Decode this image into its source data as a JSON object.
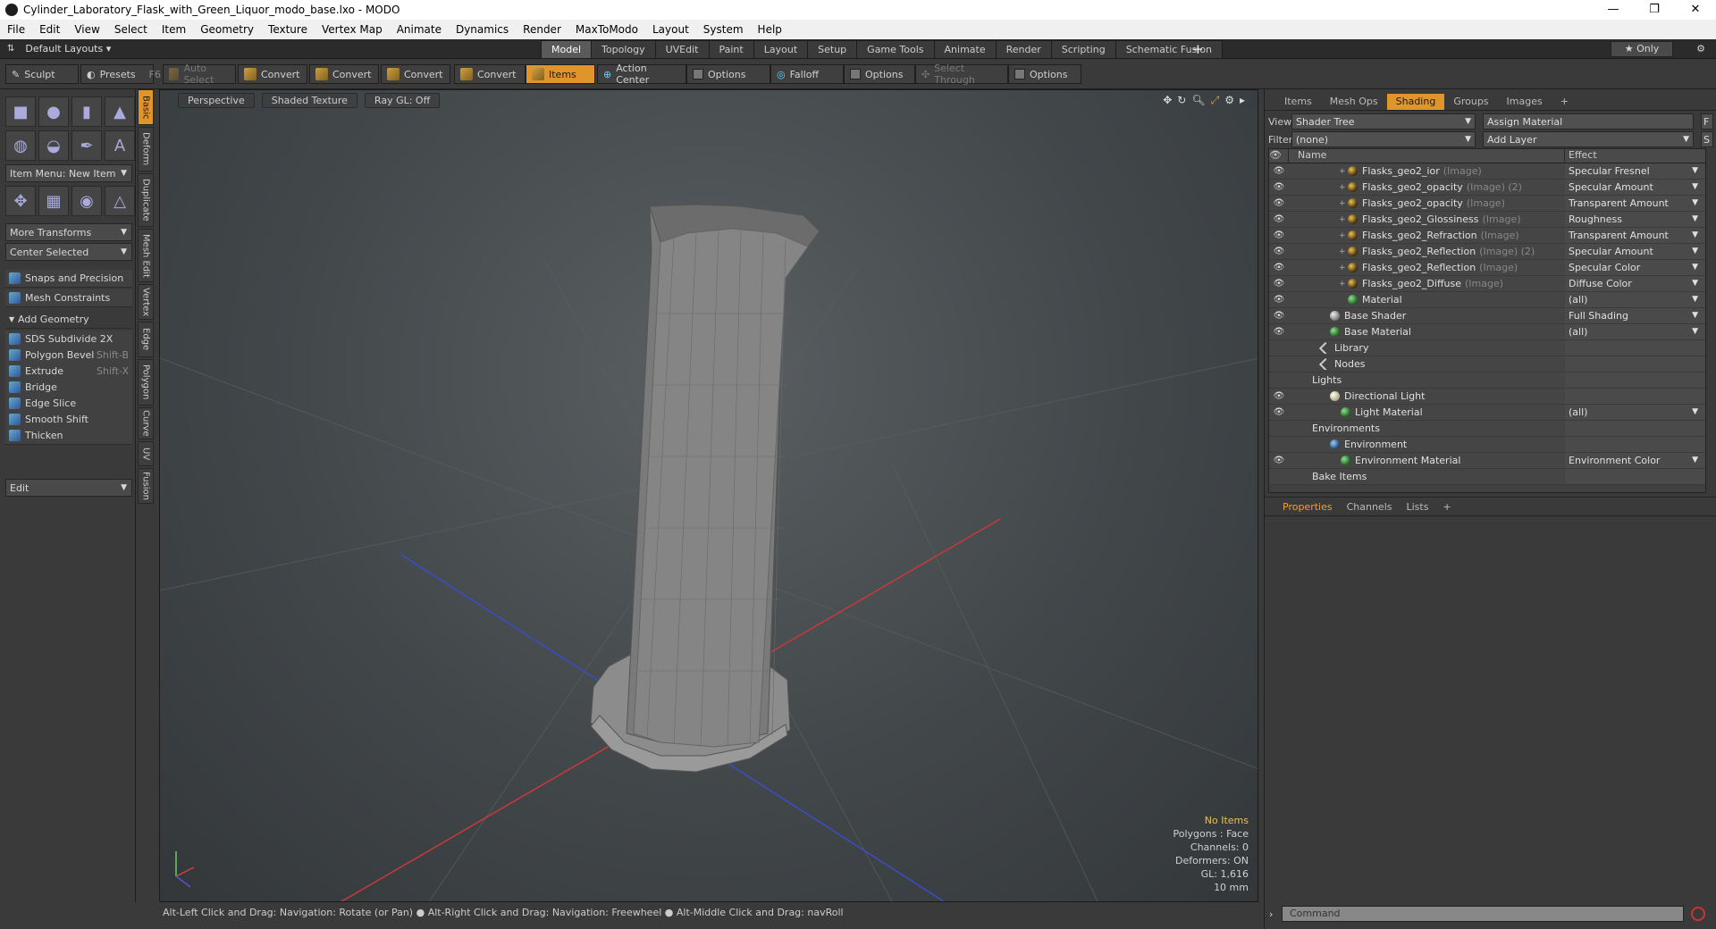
{
  "window": {
    "title": "Cylinder_Laboratory_Flask_with_Green_Liquor_modo_base.lxo - MODO",
    "minimize": "—",
    "maximize": "❐",
    "close": "✕"
  },
  "menu": [
    "File",
    "Edit",
    "View",
    "Select",
    "Item",
    "Geometry",
    "Texture",
    "Vertex Map",
    "Animate",
    "Dynamics",
    "Render",
    "MaxToModo",
    "Layout",
    "System",
    "Help"
  ],
  "layoutbar": {
    "default_layouts": "Default Layouts ▾",
    "tabs": [
      "Model",
      "Topology",
      "UVEdit",
      "Paint",
      "Layout",
      "Setup",
      "Game Tools",
      "Animate",
      "Render",
      "Scripting",
      "Schematic Fusion"
    ],
    "active_tab": "Model",
    "plus": "+",
    "only": "★  Only"
  },
  "toolbar": {
    "sculpt": "Sculpt",
    "presets": "Presets",
    "presets_shortcut": "F6",
    "auto_select": "Auto Select",
    "convert": "Convert",
    "items": "Items",
    "action_center": "Action Center",
    "options": "Options",
    "falloff": "Falloff",
    "select_through": "Select Through"
  },
  "leftpanel": {
    "item_menu": "Item Menu: New Item",
    "more_transforms": "More Transforms",
    "center_selected": "Center Selected",
    "snaps": "Snaps and Precision",
    "mesh_constraints": "Mesh Constraints",
    "add_geometry": "Add Geometry",
    "tools": [
      {
        "label": "SDS Subdivide 2X",
        "shortcut": ""
      },
      {
        "label": "Polygon Bevel",
        "shortcut": "Shift-B"
      },
      {
        "label": "Extrude",
        "shortcut": "Shift-X"
      },
      {
        "label": "Bridge",
        "shortcut": ""
      },
      {
        "label": "Edge Slice",
        "shortcut": ""
      },
      {
        "label": "Smooth Shift",
        "shortcut": ""
      },
      {
        "label": "Thicken",
        "shortcut": ""
      }
    ],
    "edit": "Edit",
    "sidetabs": [
      "Basic",
      "Deform",
      "Duplicate",
      "Mesh Edit",
      "Vertex",
      "Edge",
      "Polygon",
      "Curve",
      "UV",
      "Fusion"
    ]
  },
  "viewport": {
    "view": "Perspective",
    "shading": "Shaded Texture",
    "raygl": "Ray GL: Off",
    "info": {
      "no_items": "No Items",
      "polygons": "Polygons : Face",
      "channels": "Channels: 0",
      "deformers": "Deformers: ON",
      "gl": "GL: 1,616",
      "scale": "10 mm"
    }
  },
  "status": "Alt-Left Click and Drag: Navigation: Rotate (or Pan) ● Alt-Right Click and Drag: Navigation: Freewheel ● Alt-Middle Click and Drag: navRoll",
  "rightpanel": {
    "tabs": [
      "Items",
      "Mesh Ops",
      "Shading",
      "Groups",
      "Images",
      "+"
    ],
    "active_tab": "Shading",
    "view_label": "View",
    "view_value": "Shader Tree",
    "assign_material": "Assign Material",
    "filter_label": "Filter",
    "filter_value": "(none)",
    "add_layer": "Add Layer",
    "col_name": "Name",
    "col_effect": "Effect",
    "rows": [
      {
        "name": "Flasks_geo2_ior",
        "sub": "(Image)",
        "effect": "Specular Fresnel",
        "icon": "tex",
        "indent": 56,
        "eye": true
      },
      {
        "name": "Flasks_geo2_opacity",
        "sub": "(Image) (2)",
        "effect": "Specular Amount",
        "icon": "tex",
        "indent": 56,
        "eye": true
      },
      {
        "name": "Flasks_geo2_opacity",
        "sub": "(Image)",
        "effect": "Transparent Amount",
        "icon": "tex",
        "indent": 56,
        "eye": true
      },
      {
        "name": "Flasks_geo2_Glossiness",
        "sub": "(Image)",
        "effect": "Roughness",
        "icon": "tex",
        "indent": 56,
        "eye": true
      },
      {
        "name": "Flasks_geo2_Refraction",
        "sub": "(Image)",
        "effect": "Transparent Amount",
        "icon": "tex",
        "indent": 56,
        "eye": true
      },
      {
        "name": "Flasks_geo2_Reflection",
        "sub": "(Image) (2)",
        "effect": "Specular Amount",
        "icon": "tex",
        "indent": 56,
        "eye": true
      },
      {
        "name": "Flasks_geo2_Reflection",
        "sub": "(Image)",
        "effect": "Specular Color",
        "icon": "tex",
        "indent": 56,
        "eye": true
      },
      {
        "name": "Flasks_geo2_Diffuse",
        "sub": "(Image)",
        "effect": "Diffuse Color",
        "icon": "tex",
        "indent": 56,
        "eye": true
      },
      {
        "name": "Material",
        "sub": "",
        "effect": "(all)",
        "icon": "mat",
        "indent": 56,
        "eye": true
      },
      {
        "name": "Base Shader",
        "sub": "",
        "effect": "Full Shading",
        "icon": "shd",
        "indent": 36,
        "eye": true
      },
      {
        "name": "Base Material",
        "sub": "",
        "effect": "(all)",
        "icon": "mat",
        "indent": 36,
        "eye": true
      },
      {
        "name": "Library",
        "sub": "",
        "effect": "",
        "icon": "folder",
        "indent": 26,
        "eye": false
      },
      {
        "name": "Nodes",
        "sub": "",
        "effect": "",
        "icon": "folder",
        "indent": 26,
        "eye": false
      },
      {
        "name": "Lights",
        "sub": "",
        "effect": "",
        "icon": "none",
        "indent": 16,
        "eye": false
      },
      {
        "name": "Directional Light",
        "sub": "",
        "effect": "",
        "icon": "lit",
        "indent": 36,
        "eye": true
      },
      {
        "name": "Light Material",
        "sub": "",
        "effect": "(all)",
        "icon": "mat",
        "indent": 48,
        "eye": true
      },
      {
        "name": "Environments",
        "sub": "",
        "effect": "",
        "icon": "none",
        "indent": 16,
        "eye": false
      },
      {
        "name": "Environment",
        "sub": "",
        "effect": "",
        "icon": "env",
        "indent": 36,
        "eye": false
      },
      {
        "name": "Environment Material",
        "sub": "",
        "effect": "Environment Color",
        "icon": "mat",
        "indent": 48,
        "eye": true
      },
      {
        "name": "Bake Items",
        "sub": "",
        "effect": "",
        "icon": "none",
        "indent": 16,
        "eye": false
      }
    ],
    "props_tabs": [
      "Properties",
      "Channels",
      "Lists",
      "+"
    ],
    "command_placeholder": "Command"
  }
}
